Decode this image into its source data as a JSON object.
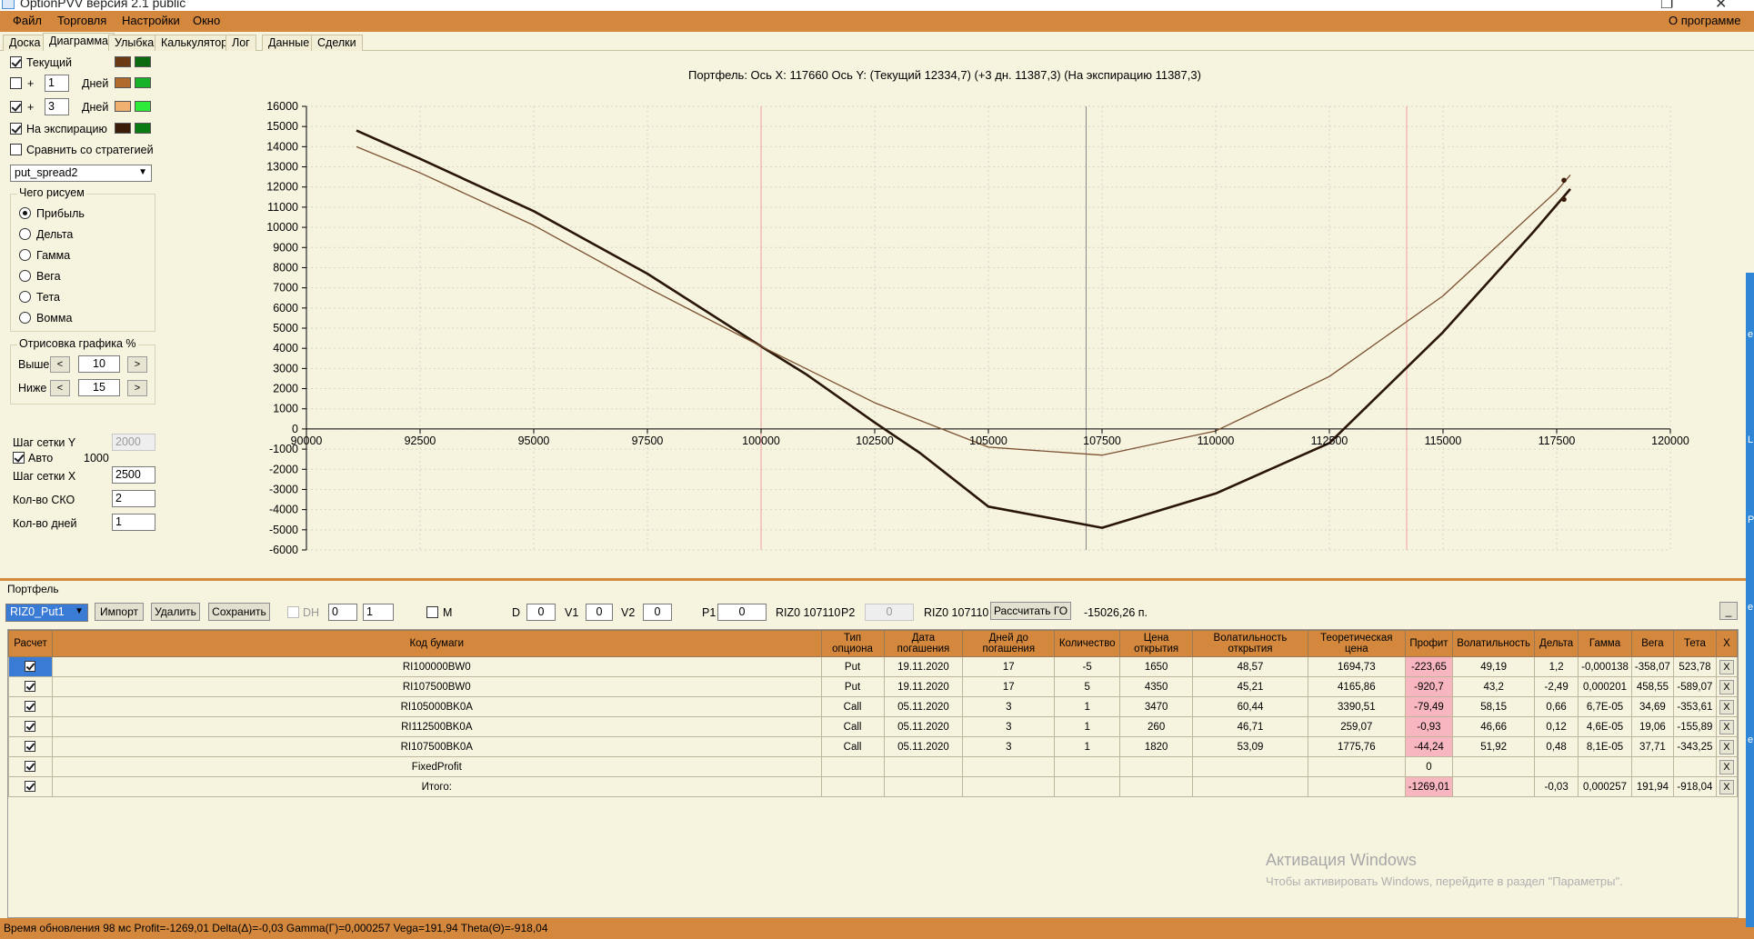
{
  "window": {
    "title": "OptionPVV версия 2.1 public"
  },
  "menu": [
    "Файл",
    "Торговля",
    "Настройки",
    "Окно"
  ],
  "menu_right": "О программе",
  "tabs": [
    "Доска",
    "Диаграмма",
    "Улыбка",
    "Калькулятор",
    "Лог",
    "Данные",
    "Сделки"
  ],
  "left_panel": {
    "tekushchiy": "Текущий",
    "plus": "+",
    "days_word": "Дней",
    "days1_value": "1",
    "days2_value": "3",
    "na_exp": "На экспирацию",
    "compare": "Сравнить со стратегией",
    "strategy": "put_spread2",
    "chego_risuem": "Чего рисуем",
    "radios": [
      "Прибыль",
      "Дельта",
      "Гамма",
      "Вега",
      "Тета",
      "Вомма"
    ],
    "otrisovka": "Отрисовка графика %",
    "vyshe": "Выше",
    "vyshe_value": "10",
    "nizhe": "Ниже",
    "nizhe_value": "15",
    "btn_left": "<",
    "btn_right": ">",
    "shag_y": "Шаг сетки Y",
    "shag_y_value": "2000",
    "avto": "Авто",
    "avto_value": "1000",
    "shag_x": "Шаг сетки X",
    "shag_x_value": "2500",
    "kolvo_sko": "Кол-во СКО",
    "kolvo_sko_value": "2",
    "kolvo_dney": "Кол-во дней",
    "kolvo_dney_value": "1"
  },
  "colors": {
    "current_a": "#6b3a14",
    "current_b": "#0a6b10",
    "d1_a": "#b06a2c",
    "d1_b": "#18b22a",
    "d3_a": "#f0b070",
    "d3_b": "#2eea3a",
    "exp_a": "#3a1c08",
    "exp_b": "#0a7a12",
    "accent": "#d4883e"
  },
  "chart_header": "Портфель: Ось X: 117660 Ось Y: (Текущий 12334,7) (+3 дн. 11387,3) (На экспирацию 11387,3)",
  "chart_data": {
    "type": "line",
    "xlim": [
      90000,
      120000
    ],
    "ylim": [
      -6000,
      16000
    ],
    "x_ticks": [
      90000,
      92500,
      95000,
      97500,
      100000,
      102500,
      105000,
      107500,
      110000,
      112500,
      115000,
      117500,
      120000
    ],
    "y_ticks": [
      16000,
      15000,
      14000,
      13000,
      12000,
      11000,
      10000,
      9000,
      8000,
      7000,
      6000,
      5000,
      4000,
      3000,
      2000,
      1000,
      0,
      -1000,
      -2000,
      -3000,
      -4000,
      -5000,
      -6000
    ],
    "vlines_red": [
      100000,
      114200
    ],
    "vline_gray": 107150,
    "series": [
      {
        "color": "#2a1608",
        "x": [
          91100,
          92500,
          95000,
          97500,
          100000,
          101000,
          102500,
          103500,
          105000,
          107500,
          110000,
          112500,
          115000,
          117000,
          117800
        ],
        "y": [
          14800,
          13400,
          10800,
          7700,
          4100,
          2700,
          320,
          -1200,
          -3850,
          -4900,
          -3200,
          -700,
          4800,
          9800,
          11900
        ]
      },
      {
        "color": "#7a5030",
        "x": [
          91100,
          92500,
          95000,
          97500,
          100000,
          102500,
          105000,
          107500,
          110000,
          112500,
          115000,
          117500,
          117800
        ],
        "y": [
          14000,
          12700,
          10100,
          7000,
          4100,
          1300,
          -900,
          -1300,
          -100,
          2600,
          6600,
          11800,
          12600
        ]
      }
    ],
    "markers": [
      {
        "x": 117660,
        "y": 12335
      },
      {
        "x": 117660,
        "y": 11387
      }
    ]
  },
  "portfolio": {
    "label": "Портфель",
    "combo": "RIZ0_Put1",
    "btn_import": "Импорт",
    "btn_delete": "Удалить",
    "btn_save": "Сохранить",
    "dh": "DH",
    "spin1": "0",
    "spin2": "1",
    "m": "M",
    "d": "D",
    "d_val": "0",
    "v1": "V1",
    "v1_val": "0",
    "v2": "V2",
    "v2_val": "0",
    "p1": "P1",
    "p1_val": "0",
    "riz_a": "RIZ0 107110",
    "p2": "P2",
    "p2_val": "0",
    "riz_b": "RIZ0 107110",
    "btn_go": "Рассчитать ГО",
    "go_value": "-15026,26 п.",
    "minimize": "_"
  },
  "table": {
    "headers": [
      "Расчет",
      "Код бумаги",
      "Тип опциона",
      "Дата погашения",
      "Дней до погашения",
      "Количество",
      "Цена открытия",
      "Волатильность открытия",
      "Теоретическая цена",
      "Профит",
      "Волатильность",
      "Дельта",
      "Гамма",
      "Вега",
      "Тета",
      "X"
    ],
    "rows": [
      [
        "RI100000BW0",
        "Put",
        "19.11.2020",
        "17",
        "-5",
        "1650",
        "48,57",
        "1694,73",
        "-223,65",
        "49,19",
        "1,2",
        "-0,000138",
        "-358,07",
        "523,78"
      ],
      [
        "RI107500BW0",
        "Put",
        "19.11.2020",
        "17",
        "5",
        "4350",
        "45,21",
        "4165,86",
        "-920,7",
        "43,2",
        "-2,49",
        "0,000201",
        "458,55",
        "-589,07"
      ],
      [
        "RI105000BK0A",
        "Call",
        "05.11.2020",
        "3",
        "1",
        "3470",
        "60,44",
        "3390,51",
        "-79,49",
        "58,15",
        "0,66",
        "6,7E-05",
        "34,69",
        "-353,61"
      ],
      [
        "RI112500BK0A",
        "Call",
        "05.11.2020",
        "3",
        "1",
        "260",
        "46,71",
        "259,07",
        "-0,93",
        "46,66",
        "0,12",
        "4,6E-05",
        "19,06",
        "-155,89"
      ],
      [
        "RI107500BK0A",
        "Call",
        "05.11.2020",
        "3",
        "1",
        "1820",
        "53,09",
        "1775,76",
        "-44,24",
        "51,92",
        "0,48",
        "8,1E-05",
        "37,71",
        "-343,25"
      ],
      [
        "FixedProfit",
        "",
        "",
        "",
        "",
        "",
        "",
        "",
        "0",
        "",
        "",
        "",
        "",
        ""
      ],
      [
        "Итого:",
        "",
        "",
        "",
        "",
        "",
        "",
        "",
        "-1269,01",
        "",
        "-0,03",
        "0,000257",
        "191,94",
        "-918,04"
      ]
    ],
    "row_x": "X"
  },
  "watermark": {
    "line1": "Активация Windows",
    "line2": "Чтобы активировать Windows, перейдите в раздел \"Параметры\"."
  },
  "status": "Время обновления 98 мс  Profit=-1269,01 Delta(Δ)=-0,03 Gamma(Γ)=0,000257 Vega=191,94 Theta(Θ)=-918,04",
  "edge_letters": [
    "е",
    "L",
    "P",
    "е",
    "е"
  ]
}
